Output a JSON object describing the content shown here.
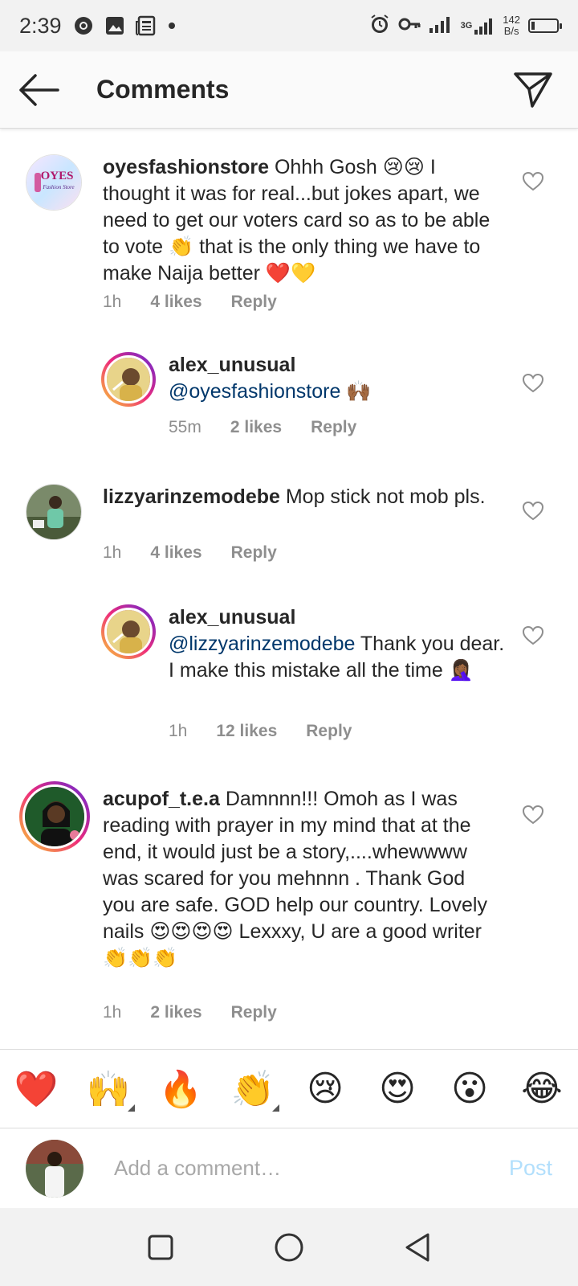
{
  "status_bar": {
    "time": "2:39",
    "net_speed_value": "142",
    "net_speed_unit": "B/s",
    "network": "3G"
  },
  "header": {
    "title": "Comments"
  },
  "comments": [
    {
      "username": "oyesfashionstore",
      "text": " Ohhh Gosh 😢😢 I thought it was for real...but jokes apart, we need to get our voters card so as to be able to vote 👏 that is the only thing we have to make Naija better ❤️💛",
      "time": "1h",
      "likes": "4 likes",
      "reply": "Reply",
      "avatar_label": "OYES",
      "avatar_sub": "Fashion Store"
    },
    {
      "username": "alex_unusual",
      "mention": "@oyesfashionstore",
      "text": " 🙌🏾",
      "time": "55m",
      "likes": "2 likes",
      "reply": "Reply"
    },
    {
      "username": "lizzyarinzemodebe",
      "text": " Mop stick not mob pls.",
      "time": "1h",
      "likes": "4 likes",
      "reply": "Reply"
    },
    {
      "username": "alex_unusual",
      "mention": "@lizzyarinzemodebe",
      "text": " Thank you dear. I make this mistake all the time 🤦🏾‍♀️",
      "time": "1h",
      "likes": "12 likes",
      "reply": "Reply"
    },
    {
      "username": "acupof_t.e.a",
      "text": " Damnnn!!! Omoh as I was reading with prayer in my mind that at the end, it would just be a story,....whewwww was scared for you mehnnn . Thank God you are safe. GOD help our country.  Lovely nails 😍😍😍😍 Lexxxy,  U are  a good writer 👏👏👏",
      "time": "1h",
      "likes": "2 likes",
      "reply": "Reply"
    }
  ],
  "quick_emojis": [
    "❤️",
    "🙌",
    "🔥",
    "👏",
    "😢",
    "😍",
    "😮",
    "😂"
  ],
  "composer": {
    "placeholder": "Add a comment…",
    "post_label": "Post"
  },
  "colors": {
    "mention": "#00376b",
    "post_disabled": "#b2dffc",
    "story_ring": "#ee2a7b"
  }
}
